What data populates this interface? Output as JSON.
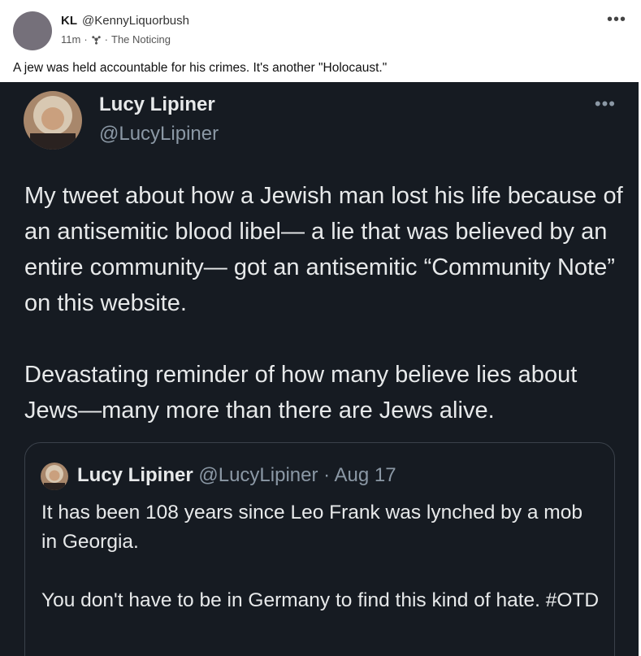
{
  "post": {
    "author_initials": "KL",
    "author_handle": "@KennyLiquorbush",
    "time": "11m",
    "dot": "·",
    "community": "The Noticing",
    "menu_icon": "more-horizontal-icon",
    "text": "A jew was held accountable for his crimes. It's another \"Holocaust.\""
  },
  "tweet": {
    "name": "Lucy Lipiner",
    "handle": "@LucyLipiner",
    "paragraphs": [
      "My tweet about how a Jewish man lost his life because of an antisemitic blood libel— a lie that was believed by an entire community— got an antisemitic “Community Note” on this website.",
      "Devastating reminder of how many believe lies about Jews—many more than there are Jews alive."
    ],
    "quoted": {
      "name": "Lucy Lipiner",
      "handle": "@LucyLipiner",
      "separator": "·",
      "date": "Aug 17",
      "paragraphs": [
        "It has been 108 years since Leo Frank was lynched by a mob in Georgia.",
        "You don't have to be in Germany to find this kind of hate. #OTD"
      ]
    }
  },
  "colors": {
    "embed_bg": "#161b22",
    "text_light": "#e7e9ea",
    "text_muted": "#8b98a5"
  }
}
